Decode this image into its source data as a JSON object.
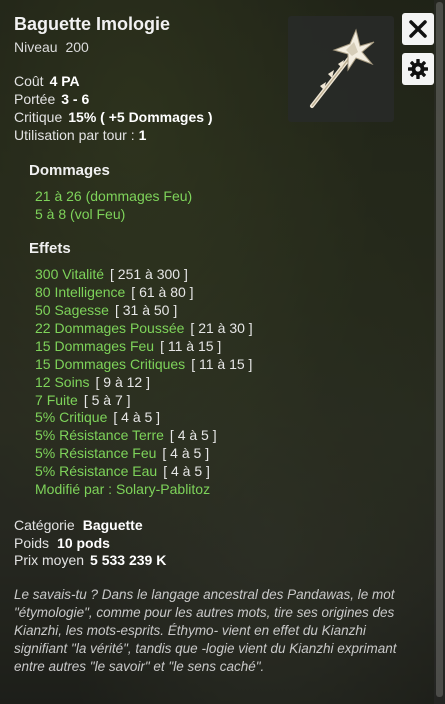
{
  "item": {
    "name": "Baguette Imologie",
    "level_label": "Niveau",
    "level": "200"
  },
  "stats": {
    "cost_label": "Coût",
    "cost": "4 PA",
    "range_label": "Portée",
    "range": "3 - 6",
    "crit_label": "Critique",
    "crit": "15% ( +5 Dommages )",
    "uses_label": "Utilisation par tour :",
    "uses": "1"
  },
  "damage": {
    "title": "Dommages",
    "lines": [
      {
        "value": "21 à 26",
        "text": "(dommages Feu)"
      },
      {
        "value": "5 à 8",
        "text": "(vol Feu)"
      }
    ]
  },
  "effects": {
    "title": "Effets",
    "lines": [
      {
        "value": "300",
        "text": "Vitalité",
        "range": "[ 251 à 300 ]"
      },
      {
        "value": "80",
        "text": "Intelligence",
        "range": "[ 61 à 80 ]"
      },
      {
        "value": "50",
        "text": "Sagesse",
        "range": "[ 31 à 50 ]"
      },
      {
        "value": "22",
        "text": "Dommages Poussée",
        "range": "[ 21 à 30 ]"
      },
      {
        "value": "15",
        "text": "Dommages Feu",
        "range": "[ 11 à 15 ]"
      },
      {
        "value": "15",
        "text": "Dommages Critiques",
        "range": "[ 11 à 15 ]"
      },
      {
        "value": "12",
        "text": "Soins",
        "range": "[ 9 à 12 ]"
      },
      {
        "value": "7",
        "text": "Fuite",
        "range": "[ 5 à 7 ]"
      },
      {
        "value": "5%",
        "text": "Critique",
        "range": "[ 4 à 5 ]"
      },
      {
        "value": "5%",
        "text": "Résistance Terre",
        "range": "[ 4 à 5 ]"
      },
      {
        "value": "5%",
        "text": "Résistance Feu",
        "range": "[ 4 à 5 ]"
      },
      {
        "value": "5%",
        "text": "Résistance Eau",
        "range": "[ 4 à 5 ]"
      }
    ],
    "modified_label": "Modifié par :",
    "modified_by": "Solary-Pablitoz"
  },
  "info": {
    "category_label": "Catégorie",
    "category": "Baguette",
    "weight_label": "Poids",
    "weight": "10 pods",
    "price_label": "Prix moyen",
    "price": "5 533 239 K"
  },
  "lore": "Le savais-tu ? Dans le langage ancestral des Pandawas, le mot \"étymologie\", comme pour les autres mots, tire ses origines des Kianzhi, les mots-esprits. Éthymo- vient en effet du Kianzhi signifiant \"la vérité\", tandis que -logie vient du Kianzhi exprimant entre autres \"le savoir\" et \"le sens caché\".",
  "icons": {
    "close": "close-icon",
    "settings": "gear-icon",
    "item": "wand-icon"
  },
  "colors": {
    "effect_green": "#7ed35a",
    "button_bg": "#f4f4f4"
  }
}
